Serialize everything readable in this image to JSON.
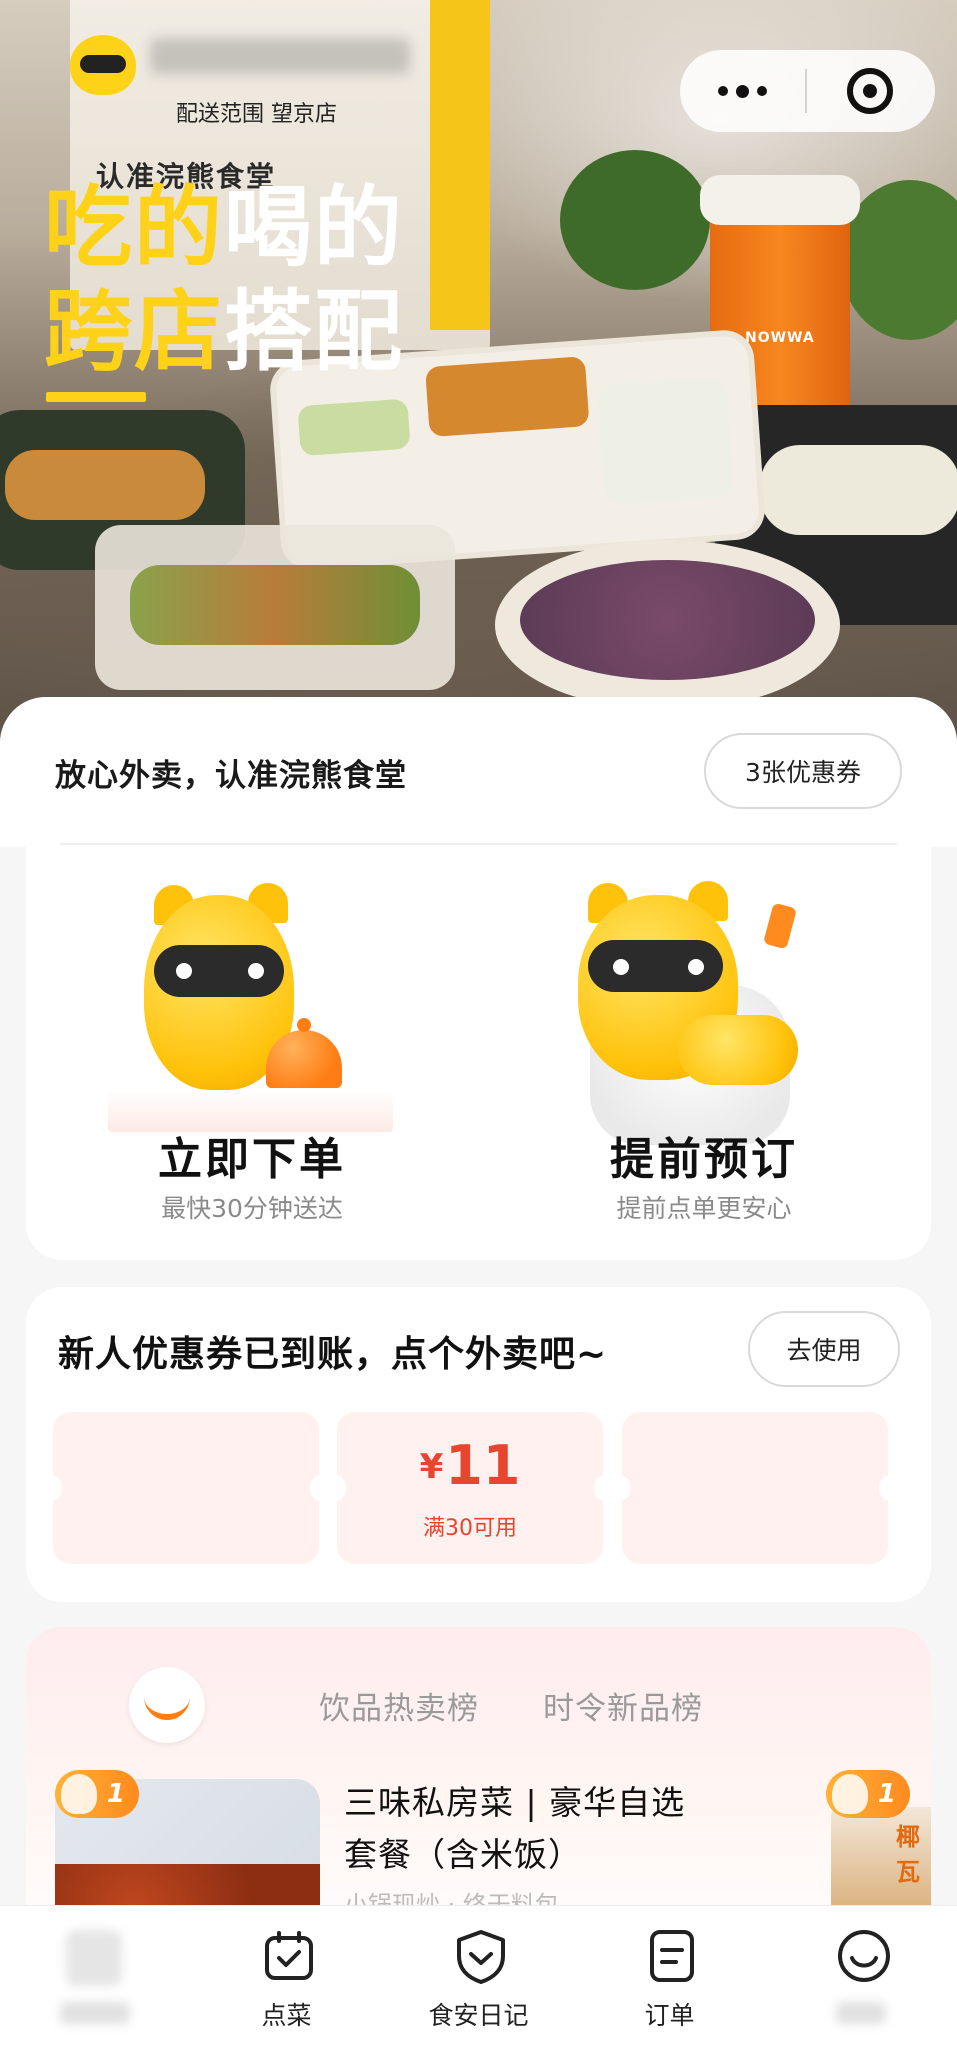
{
  "hero": {
    "headline_line1_a": "吃的",
    "headline_line1_b": "喝的",
    "headline_line2_a": "跨店",
    "headline_line2_b": "搭配",
    "bag_text": "认准浣熊食堂",
    "delivery_range": "配送范围  望京店",
    "cup_brand": "NOWWA"
  },
  "capsule": {
    "more_icon": "more-dots-icon",
    "close_icon": "close-target-icon"
  },
  "header": {
    "slogan": "放心外卖，认准浣熊食堂",
    "coupon_button": "3张优惠券"
  },
  "order_options": [
    {
      "title": "立即下单",
      "subtitle": "最快30分钟送达",
      "icon": "raccoon-serving-icon"
    },
    {
      "title": "提前预订",
      "subtitle": "提前点单更安心",
      "icon": "raccoon-phone-icon"
    }
  ],
  "newcomer": {
    "title": "新人优惠券已到账，点个外卖吧~",
    "use_button": "去使用",
    "coupon": {
      "currency": "¥",
      "amount": "11",
      "condition": "满30可用"
    }
  },
  "ranking": {
    "tabs": [
      "饮品热卖榜",
      "时令新品榜"
    ],
    "items": [
      {
        "rank": "1",
        "name": "三味私房菜 | 豪华自选套餐（含米饭）",
        "subtitle": "小锅现炒 · 终于料包"
      },
      {
        "rank": "1",
        "brand": "椰瓦"
      }
    ]
  },
  "tabbar": {
    "items": [
      {
        "label": "",
        "icon": "home-icon"
      },
      {
        "label": "点菜",
        "icon": "order-food-icon"
      },
      {
        "label": "食安日记",
        "icon": "shield-check-icon"
      },
      {
        "label": "订单",
        "icon": "order-list-icon"
      },
      {
        "label": "",
        "icon": "profile-icon"
      }
    ]
  },
  "colors": {
    "brand_yellow": "#ffd21a",
    "coupon_red": "#e8452f",
    "accent_orange": "#ff8a1e"
  }
}
